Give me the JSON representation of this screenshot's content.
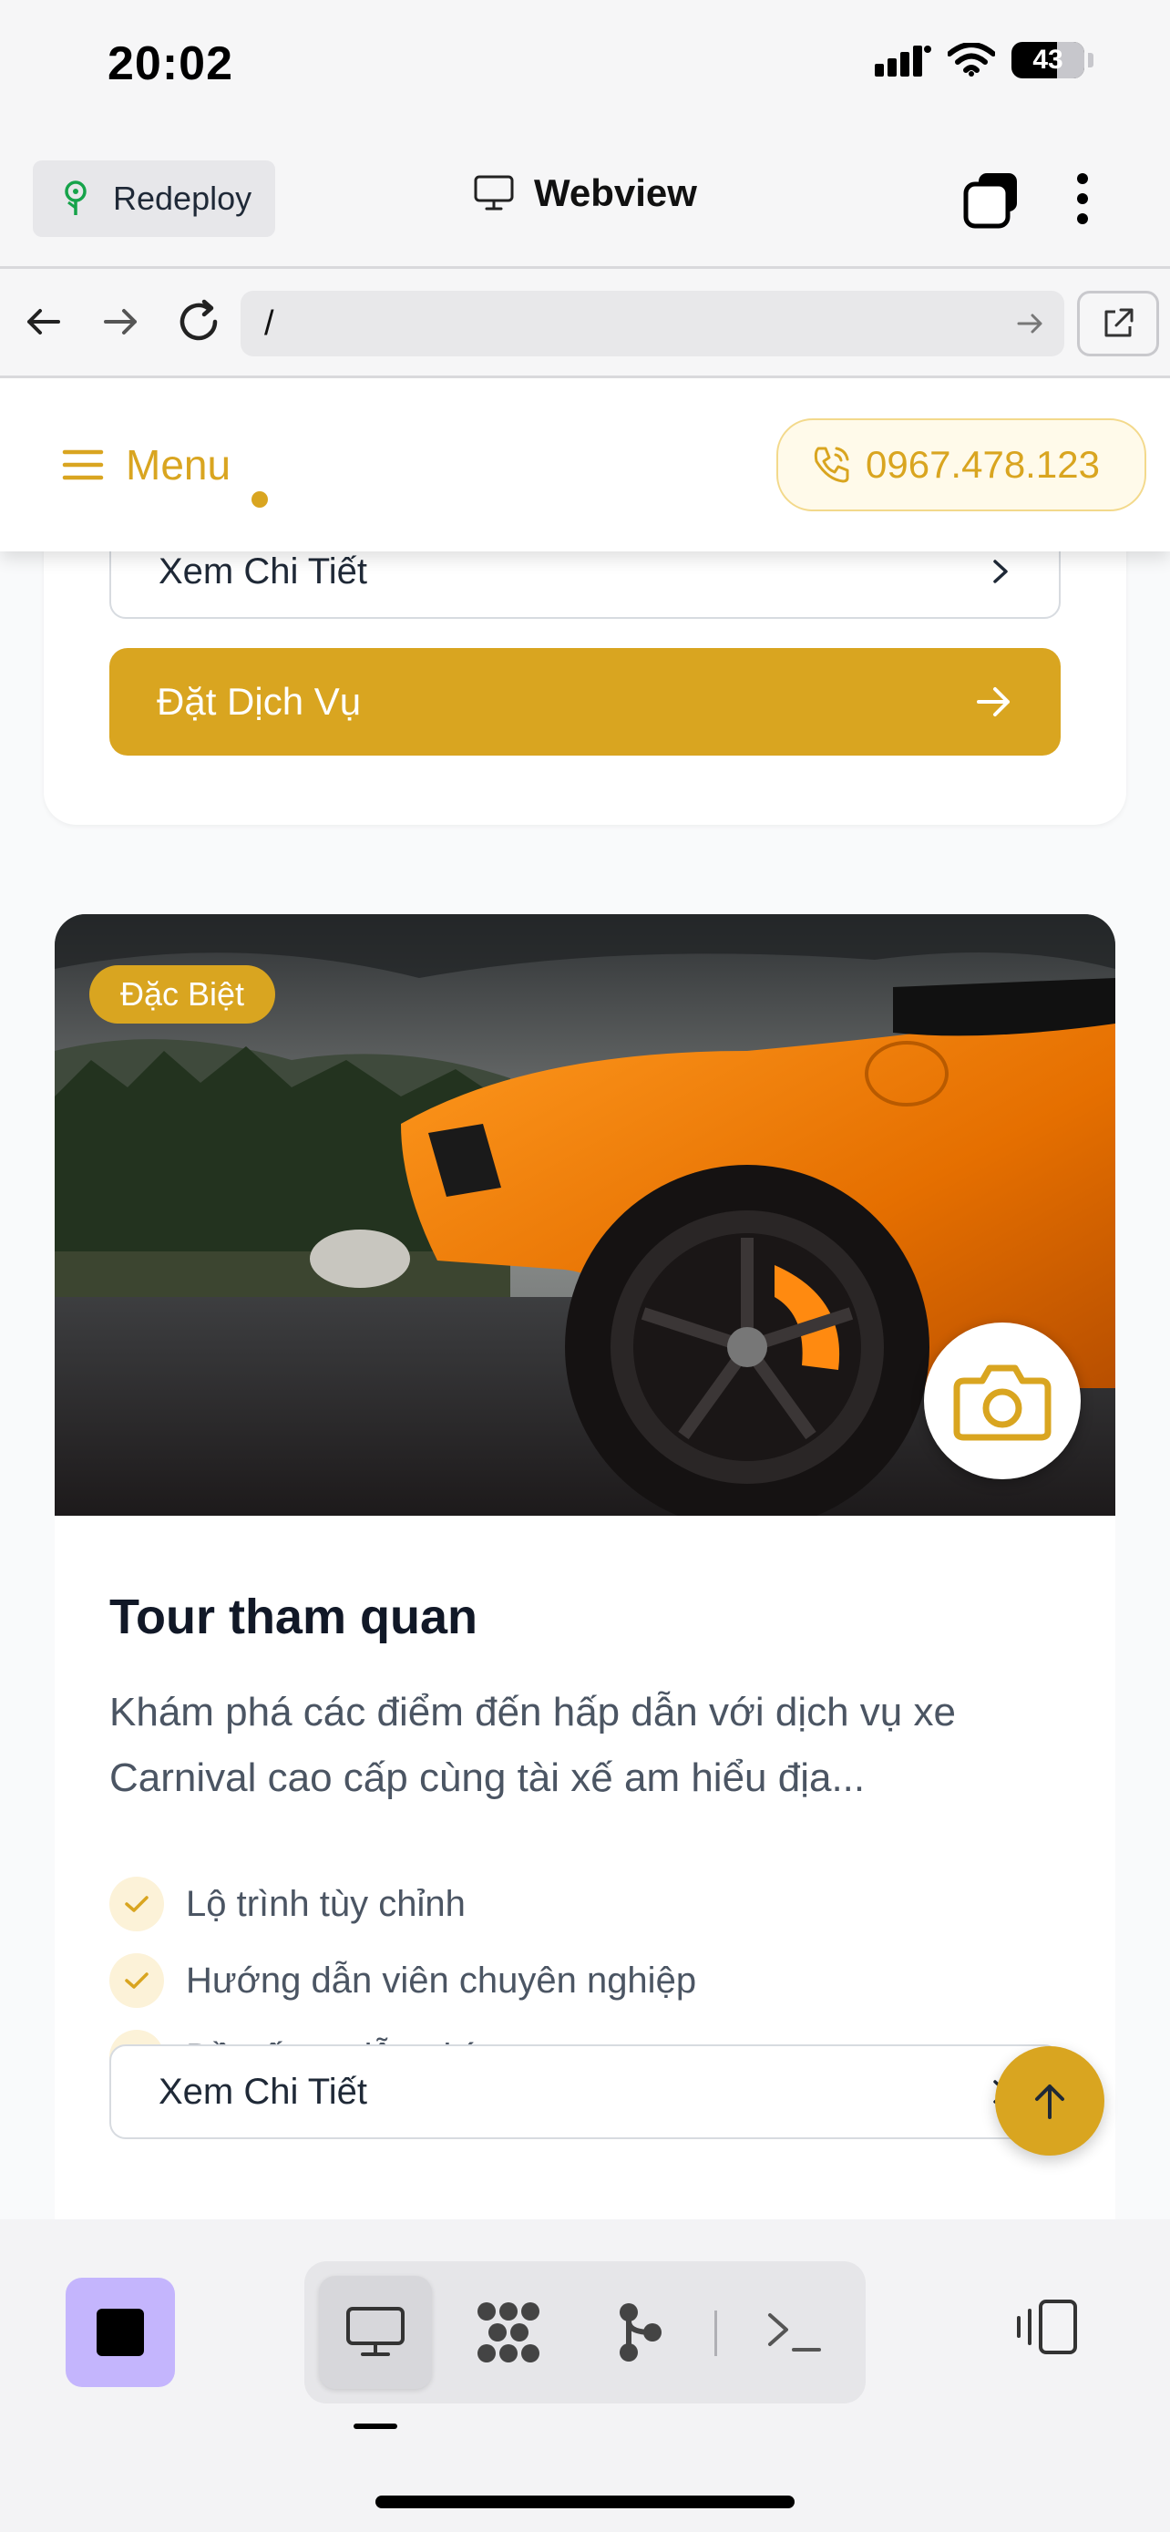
{
  "status_bar": {
    "time": "20:02",
    "battery": "43"
  },
  "browser": {
    "redeploy_label": "Redeploy",
    "title": "Webview",
    "url": "/"
  },
  "site_header": {
    "menu_label": "Menu",
    "phone": "0967.478.123"
  },
  "previous_card": {
    "detail_label": "Xem Chi Tiết",
    "book_label": "Đặt Dịch Vụ"
  },
  "service_card": {
    "badge": "Đặc Biệt",
    "title": "Tour tham quan",
    "description": "Khám phá các điểm đến hấp dẫn với dịch vụ xe Carnival cao cấp cùng tài xế am hiểu địa...",
    "features": [
      "Lộ trình tùy chỉnh",
      "Hướng dẫn viên chuyên nghiệp",
      "Đồ uống miễn phí"
    ],
    "detail_label": "Xem Chi Tiết"
  },
  "colors": {
    "accent": "#d9a520",
    "stop_button": "#c4b5fd"
  },
  "icons": {
    "redeploy": "tree-icon",
    "webview": "monitor-icon",
    "tabs": "tabs-icon",
    "more": "kebab-menu-icon",
    "phone": "phone-icon",
    "hero": "camera-icon",
    "scroll": "arrow-up-icon"
  }
}
